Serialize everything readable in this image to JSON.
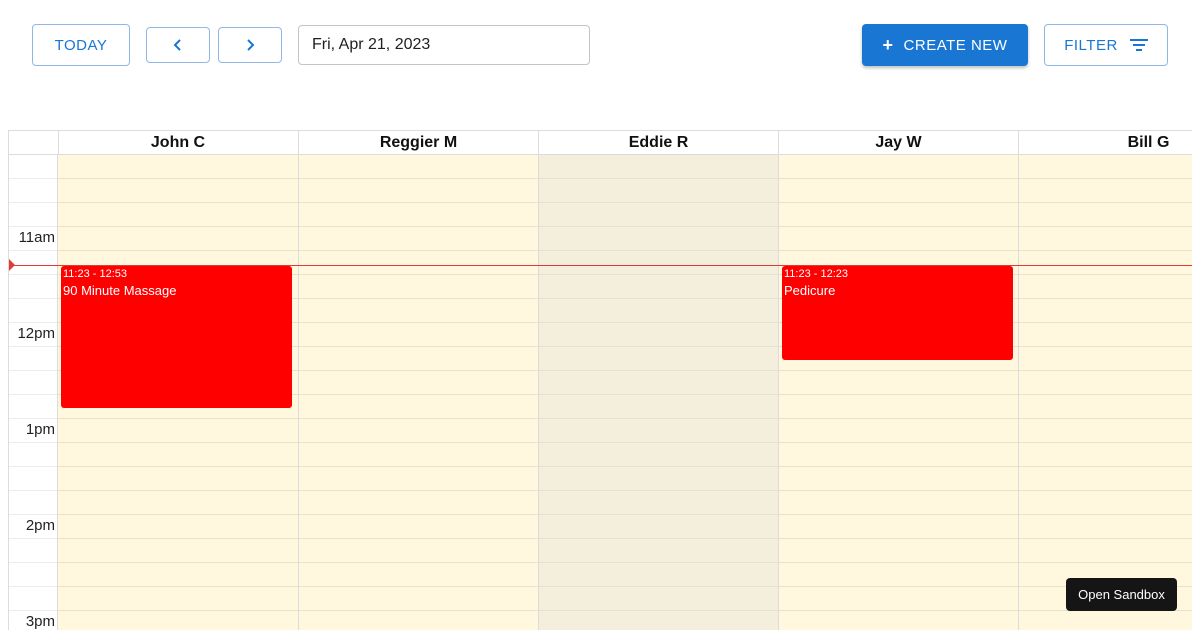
{
  "toolbar": {
    "today_label": "TODAY",
    "prev_icon": "chevron-left-icon",
    "next_icon": "chevron-right-icon",
    "date_value": "Fri, Apr 21, 2023",
    "create_label": "CREATE NEW",
    "create_icon": "plus-icon",
    "filter_label": "FILTER",
    "filter_icon": "filter-icon"
  },
  "calendar": {
    "resources": [
      "John C",
      "Reggier M",
      "Eddie R",
      "Jay W",
      "Bill G"
    ],
    "time_labels": [
      "11am",
      "12pm",
      "1pm",
      "2pm",
      "3pm"
    ],
    "events": [
      {
        "resource": "John C",
        "time": "11:23 - 12:53",
        "title": "90 Minute Massage"
      },
      {
        "resource": "Jay W",
        "time": "11:23 - 12:23",
        "title": "Pedicure"
      }
    ]
  },
  "colors": {
    "accent": "#1976d2",
    "event": "#ff0000",
    "now_line": "#e53935",
    "available_bg": "#fff8df",
    "unavailable_bg": "#f3efdc"
  },
  "sandbox_label": "Open Sandbox"
}
